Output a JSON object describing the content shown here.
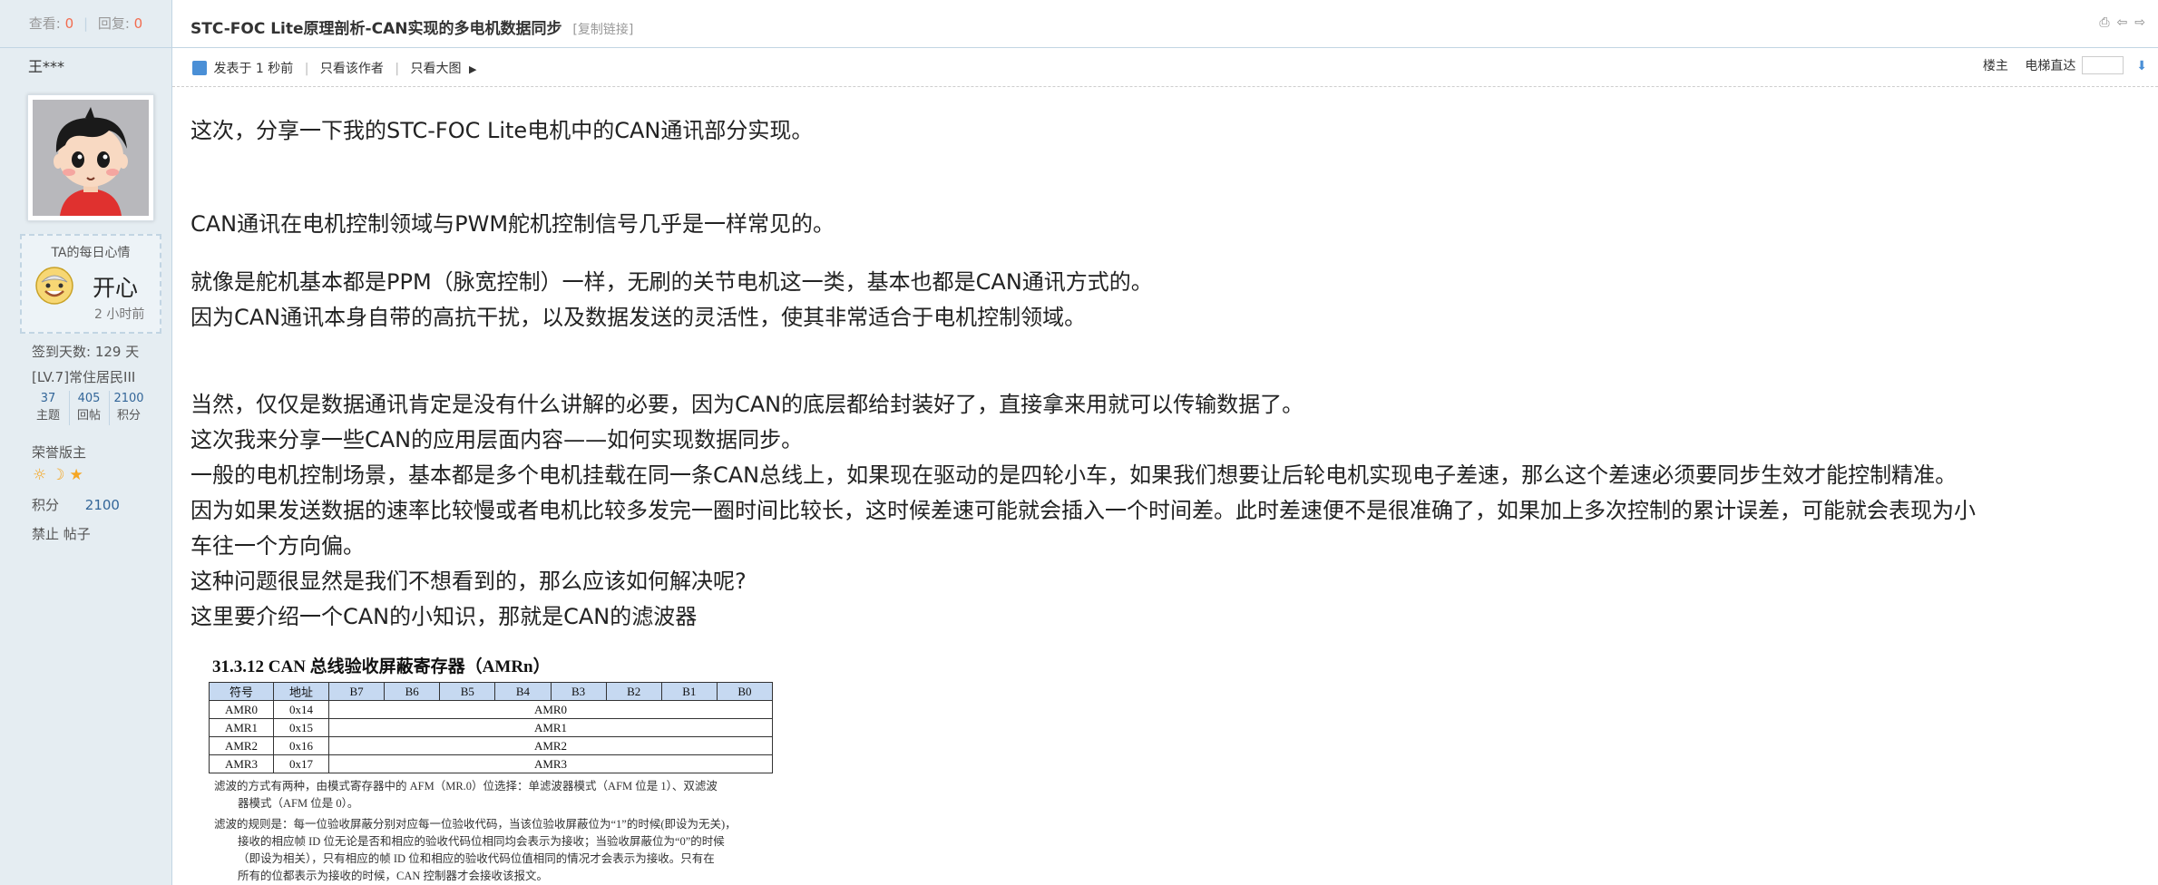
{
  "stats": {
    "views_label": "查看:",
    "views": "0",
    "replies_label": "回复:",
    "replies": "0"
  },
  "thread": {
    "title": "STC-FOC Lite原理剖析-CAN实现的多电机数据同步",
    "copy_link": "[复制链接]"
  },
  "author": {
    "name": "王***",
    "mood_title": "TA的每日心情",
    "mood": "开心",
    "mood_time": "2 小时前",
    "signin": "签到天数: 129 天",
    "level": "[LV.7]常住居民III",
    "counts": [
      {
        "value": "37",
        "label": "主题"
      },
      {
        "value": "405",
        "label": "回帖"
      },
      {
        "value": "2100",
        "label": "积分"
      }
    ],
    "honor": "荣誉版主",
    "points_label": "积分",
    "points": "2100",
    "banned": "禁止 帖子"
  },
  "meta": {
    "posted": "发表于 1 秒前",
    "only_author": "只看该作者",
    "only_image": "只看大图",
    "floor_owner": "楼主",
    "elevator": "电梯直达"
  },
  "content": {
    "p1": "这次，分享一下我的STC-FOC Lite电机中的CAN通讯部分实现。",
    "p2": "CAN通讯在电机控制领域与PWM舵机控制信号几乎是一样常见的。",
    "p3": "就像是舵机基本都是PPM（脉宽控制）一样，无刷的关节电机这一类，基本也都是CAN通讯方式的。",
    "p4": "因为CAN通讯本身自带的高抗干扰，以及数据发送的灵活性，使其非常适合于电机控制领域。",
    "p5": "当然，仅仅是数据通讯肯定是没有什么讲解的必要，因为CAN的底层都给封装好了，直接拿来用就可以传输数据了。",
    "p6": "这次我来分享一些CAN的应用层面内容——如何实现数据同步。",
    "p7": "一般的电机控制场景，基本都是多个电机挂载在同一条CAN总线上，如果现在驱动的是四轮小车，如果我们想要让后轮电机实现电子差速，那么这个差速必须要同步生效才能控制精准。",
    "p8a": "因为如果发送数据的速率比较慢或者电机比较多发完一圈时间比较长，这时候差速可能就会插入一个时间差。此时差速便不是很准确了，如果加上多次控制的累计误差，可能就会表现为小",
    "p8b": "车往一个方向偏。",
    "p9": "这种问题很显然是我们不想看到的，那么应该如何解决呢?",
    "p10": "这里要介绍一个CAN的小知识，那就是CAN的滤波器"
  },
  "doc": {
    "heading": "31.3.12    CAN 总线验收屏蔽寄存器（AMRn）",
    "headers": [
      "符号",
      "地址",
      "B7",
      "B6",
      "B5",
      "B4",
      "B3",
      "B2",
      "B1",
      "B0"
    ],
    "rows": [
      {
        "sym": "AMR0",
        "addr": "0x14",
        "val": "AMR0"
      },
      {
        "sym": "AMR1",
        "addr": "0x15",
        "val": "AMR1"
      },
      {
        "sym": "AMR2",
        "addr": "0x16",
        "val": "AMR2"
      },
      {
        "sym": "AMR3",
        "addr": "0x17",
        "val": "AMR3"
      }
    ],
    "note1": "滤波的方式有两种，由模式寄存器中的 AFM（MR.0）位选择：单滤波器模式（AFM 位是 1）、双滤波",
    "note2": "器模式（AFM 位是 0）。",
    "note3": "滤波的规则是：每一位验收屏蔽分别对应每一位验收代码，当该位验收屏蔽位为“1”的时候(即设为无关)，",
    "note4": "接收的相应帧 ID 位无论是否和相应的验收代码位相同均会表示为接收；当验收屏蔽位为“0”的时候",
    "note5": "（即设为相关），只有相应的帧 ID 位和相应的验收代码位值相同的情况才会表示为接收。只有在",
    "note6": "所有的位都表示为接收的时候，CAN 控制器才会接收该报文。"
  }
}
